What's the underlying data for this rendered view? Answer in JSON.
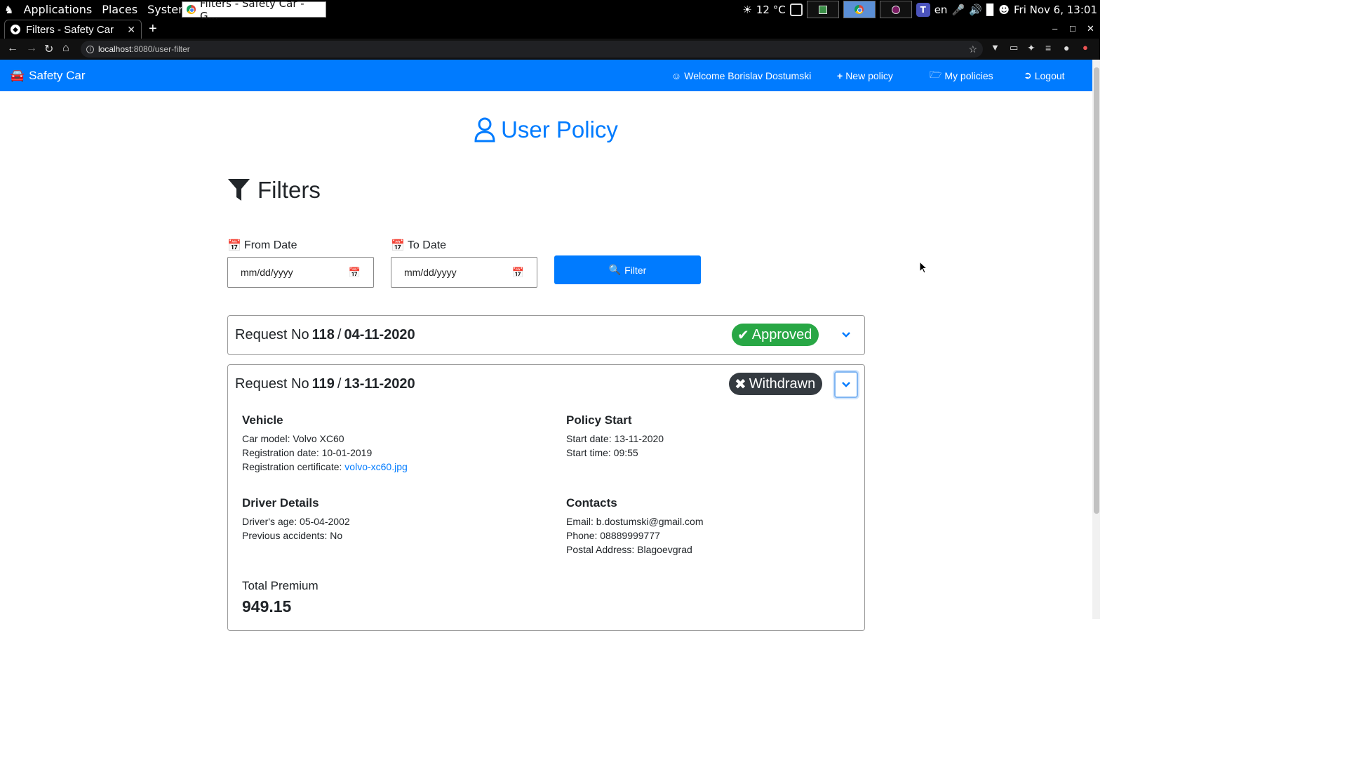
{
  "os": {
    "menu": [
      "Applications",
      "Places",
      "System"
    ],
    "task_title": "Filters - Safety Car - G...",
    "weather": "12 °C",
    "lang": "en",
    "clock": "Fri Nov  6, 13:01"
  },
  "browser": {
    "tab_title": "Filters - Safety Car",
    "url_host": "localhost",
    "url_rest": ":8080/user-filter"
  },
  "navbar": {
    "brand": "Safety Car",
    "welcome": "Welcome Borislav Dostumski",
    "new_policy": "New policy",
    "my_policies": "My policies",
    "logout": "Logout"
  },
  "page": {
    "title": "User Policy",
    "filters_heading": "Filters",
    "from_label": "From Date",
    "to_label": "To Date",
    "from_placeholder": "mm/dd/yyyy",
    "to_placeholder": "mm/dd/yyyy",
    "filter_button": "Filter"
  },
  "requests": [
    {
      "prefix": "Request No",
      "number": "118",
      "sep": "/",
      "date": "04-11-2020",
      "status": "Approved",
      "status_color": "#28a745"
    },
    {
      "prefix": "Request No",
      "number": "119",
      "sep": "/",
      "date": "13-11-2020",
      "status": "Withdrawn",
      "status_color": "#343a40",
      "vehicle_title": "Vehicle",
      "car_model": "Car model: Volvo XC60",
      "reg_date": "Registration date: 10-01-2019",
      "reg_cert_label": "Registration certificate: ",
      "reg_cert_link": "volvo-xc60.jpg",
      "policy_start_title": "Policy Start",
      "start_date": "Start date: 13-11-2020",
      "start_time": "Start time: 09:55",
      "driver_title": "Driver Details",
      "driver_age": "Driver's age: 05-04-2002",
      "prev_accidents": "Previous accidents: No",
      "contacts_title": "Contacts",
      "email": "Email: b.dostumski@gmail.com",
      "phone": "Phone: 08889999777",
      "postal": "Postal Address: Blagoevgrad",
      "total_premium_label": "Total Premium",
      "total_premium_value": "949.15"
    }
  ]
}
